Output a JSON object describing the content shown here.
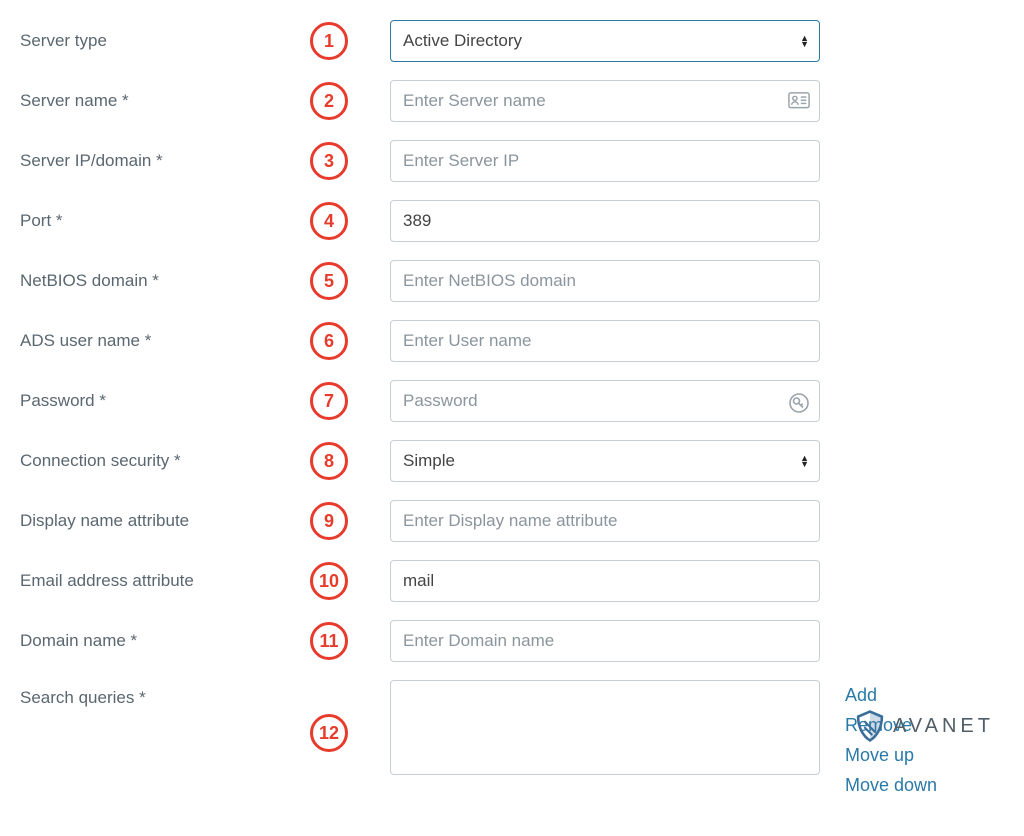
{
  "fields": {
    "server_type": {
      "label": "Server type",
      "marker": "1",
      "value": "Active Directory"
    },
    "server_name": {
      "label": "Server name *",
      "marker": "2",
      "placeholder": "Enter Server name"
    },
    "server_ip": {
      "label": "Server IP/domain *",
      "marker": "3",
      "placeholder": "Enter Server IP"
    },
    "port": {
      "label": "Port *",
      "marker": "4",
      "value": "389"
    },
    "netbios": {
      "label": "NetBIOS domain *",
      "marker": "5",
      "placeholder": "Enter NetBIOS domain"
    },
    "ads_user": {
      "label": "ADS user name *",
      "marker": "6",
      "placeholder": "Enter User name"
    },
    "password": {
      "label": "Password *",
      "marker": "7",
      "placeholder": "Password"
    },
    "conn_sec": {
      "label": "Connection security *",
      "marker": "8",
      "value": "Simple"
    },
    "display_attr": {
      "label": "Display name attribute",
      "marker": "9",
      "placeholder": "Enter Display name attribute"
    },
    "email_attr": {
      "label": "Email address attribute",
      "marker": "10",
      "value": "mail"
    },
    "domain_name": {
      "label": "Domain name *",
      "marker": "11",
      "placeholder": "Enter Domain name"
    },
    "search_queries": {
      "label": "Search queries *",
      "marker": "12",
      "value": ""
    }
  },
  "actions": {
    "add": "Add",
    "remove": "Remove",
    "move_up": "Move up",
    "move_down": "Move down"
  },
  "logo_text": "AVANET"
}
